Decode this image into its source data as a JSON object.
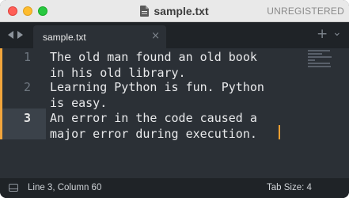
{
  "window": {
    "title": "sample.txt",
    "license_label": "UNREGISTERED"
  },
  "tabs": {
    "items": [
      {
        "label": "sample.txt",
        "close": "×",
        "active": true
      }
    ],
    "new_tab": "+",
    "overflow": "⌄"
  },
  "editor": {
    "lines": [
      {
        "number": "1",
        "text": "The old man found an old book\nin his old library."
      },
      {
        "number": "2",
        "text": "Learning Python is fun. Python\nis easy."
      },
      {
        "number": "3",
        "text": "An error in the code caused a\nmajor error during execution."
      }
    ],
    "current_line": 3,
    "theme": {
      "background": "#2b3036",
      "text": "#e9eaec",
      "gutter_text": "#6f7780",
      "cursor": "#f6a032",
      "modified_marker": "#f2a53c"
    }
  },
  "statusbar": {
    "position": "Line 3, Column 60",
    "tab_size": "Tab Size: 4"
  },
  "icons": {
    "file": "file-icon",
    "nav_back": "chevron-left-icon",
    "nav_forward": "chevron-right-icon",
    "panel": "panel-toggle-icon"
  }
}
